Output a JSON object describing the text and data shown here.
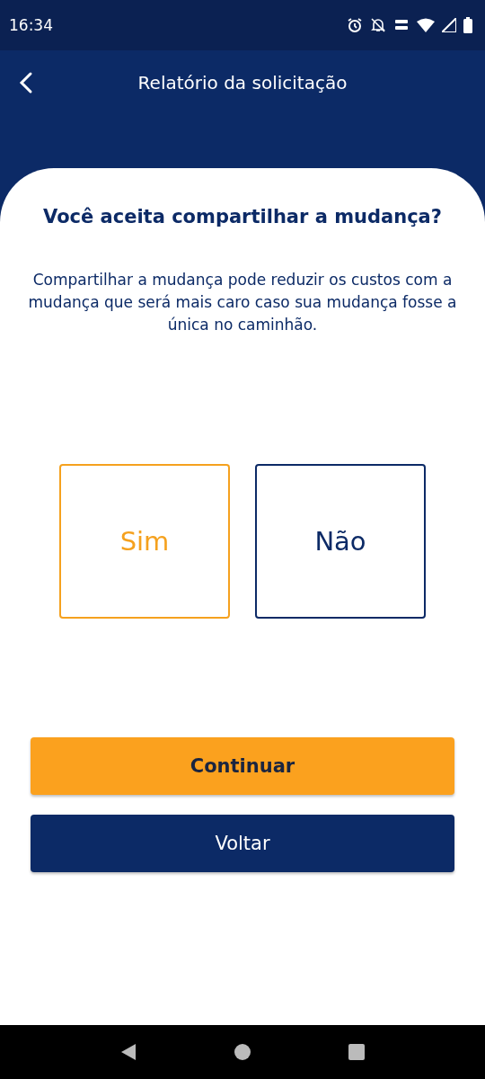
{
  "status_bar": {
    "time": "16:34"
  },
  "header": {
    "title": "Relatório da solicitação"
  },
  "question": "Você aceita compartilhar a mudança?",
  "description": "Compartilhar a mudança pode reduzir os custos com a mudança que será mais caro caso sua mudança fosse a única no caminhão.",
  "options": [
    {
      "label": "Sim",
      "selected": true
    },
    {
      "label": "Não",
      "selected": false
    }
  ],
  "buttons": [
    {
      "label": "Continuar",
      "kind": "primary"
    },
    {
      "label": "Voltar",
      "kind": "secondary"
    }
  ]
}
